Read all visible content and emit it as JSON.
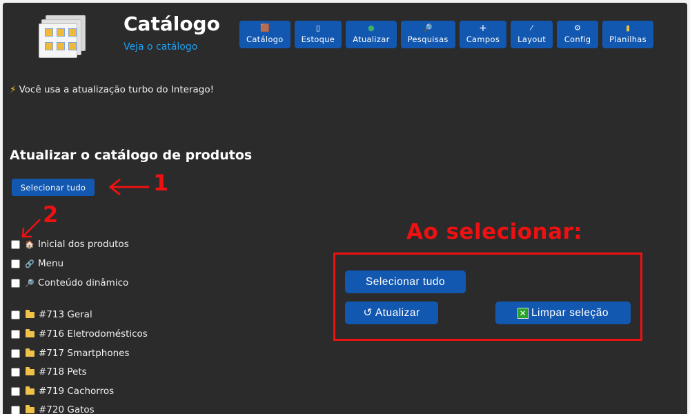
{
  "header": {
    "title": "Catálogo",
    "subtitle_link": "Veja o catálogo"
  },
  "toolbar": [
    {
      "label": "Catálogo",
      "icon": "box-icon",
      "glyph": "🟫"
    },
    {
      "label": "Estoque",
      "icon": "clipboard-icon",
      "glyph": "▯"
    },
    {
      "label": "Atualizar",
      "icon": "globe-icon",
      "glyph": "●"
    },
    {
      "label": "Pesquisas",
      "icon": "magnifier-icon",
      "glyph": "🔎"
    },
    {
      "label": "Campos",
      "icon": "plus-icon",
      "glyph": "+"
    },
    {
      "label": "Layout",
      "icon": "brush-icon",
      "glyph": "⁄"
    },
    {
      "label": "Config",
      "icon": "gear-icon",
      "glyph": "⚙"
    },
    {
      "label": "Planilhas",
      "icon": "chart-icon",
      "glyph": "▮"
    }
  ],
  "notice": "Você usa a atualização turbo do Interago!",
  "section": {
    "title": "Atualizar o catálogo de produtos",
    "select_all_label": "Selecionar tudo"
  },
  "annotations": {
    "marker_1": "1",
    "marker_2": "2",
    "heading": "Ao selecionar:",
    "color": "#ee1111"
  },
  "checklist_static": [
    {
      "label": "Inicial dos produtos",
      "icon": "house-icon",
      "glyph": "🏠"
    },
    {
      "label": "Menu",
      "icon": "link-icon",
      "glyph": "🔗"
    },
    {
      "label": "Conteúdo dinâmico",
      "icon": "magnifier-icon",
      "glyph": "🔎"
    }
  ],
  "checklist_categories": [
    {
      "label": "#713 Geral"
    },
    {
      "label": "#716 Eletrodomésticos"
    },
    {
      "label": "#717 Smartphones"
    },
    {
      "label": "#718 Pets"
    },
    {
      "label": "#719 Cachorros"
    },
    {
      "label": "#720 Gatos"
    }
  ],
  "preview_buttons": {
    "select_all": "Selecionar tudo",
    "update": "↺ Atualizar",
    "clear": "Limpar seleção"
  },
  "colors": {
    "background": "#2b2b2c",
    "button": "#1358b0",
    "link": "#1fa0f0"
  }
}
